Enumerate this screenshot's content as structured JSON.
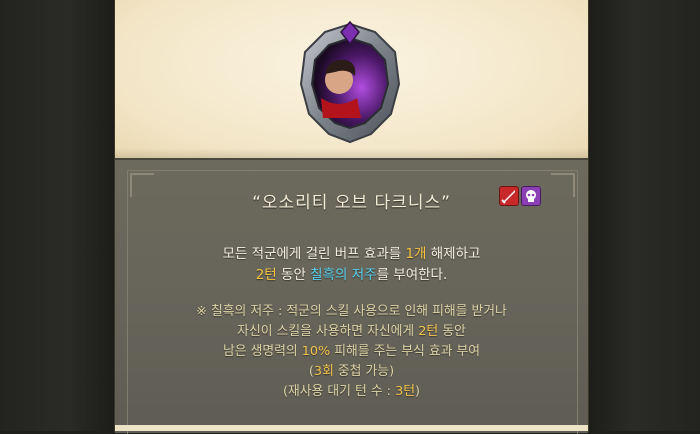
{
  "skill": {
    "title": "“오소리티 오브 다크니스”",
    "tags": [
      "attack-icon",
      "debuff-icon"
    ],
    "desc_line1_a": "모든 적군에게 걸린 버프 효과를 ",
    "desc_line1_hl": "1개",
    "desc_line1_b": " 해제하고",
    "desc_line2_hl1": "2턴",
    "desc_line2_a": " 동안 ",
    "desc_line2_hl2": "칠흑의 저주",
    "desc_line2_b": "를 부여한다.",
    "note_line1": "※ 칠흑의 저주 : 적군의 스킬 사용으로 인해 피해를 받거나",
    "note_line2_a": "자신이 스킬을 사용하면 자신에게 ",
    "note_line2_hl": "2턴",
    "note_line2_b": " 동안",
    "note_line3_a": "남은 생명력의 ",
    "note_line3_hl": "10%",
    "note_line3_b": " 피해를 주는 부식 효과 부여",
    "note_line4_a": "(",
    "note_line4_hl": "3회",
    "note_line4_b": " 중첩 가능)",
    "note_line5_a": "(재사용 대기 턴 수 : ",
    "note_line5_hl": "3턴",
    "note_line5_b": ")"
  },
  "colors": {
    "highlight_yellow": "#f5c542",
    "highlight_cyan": "#57d0ee",
    "panel": "#67655a",
    "parchment": "#f6ecd5"
  }
}
